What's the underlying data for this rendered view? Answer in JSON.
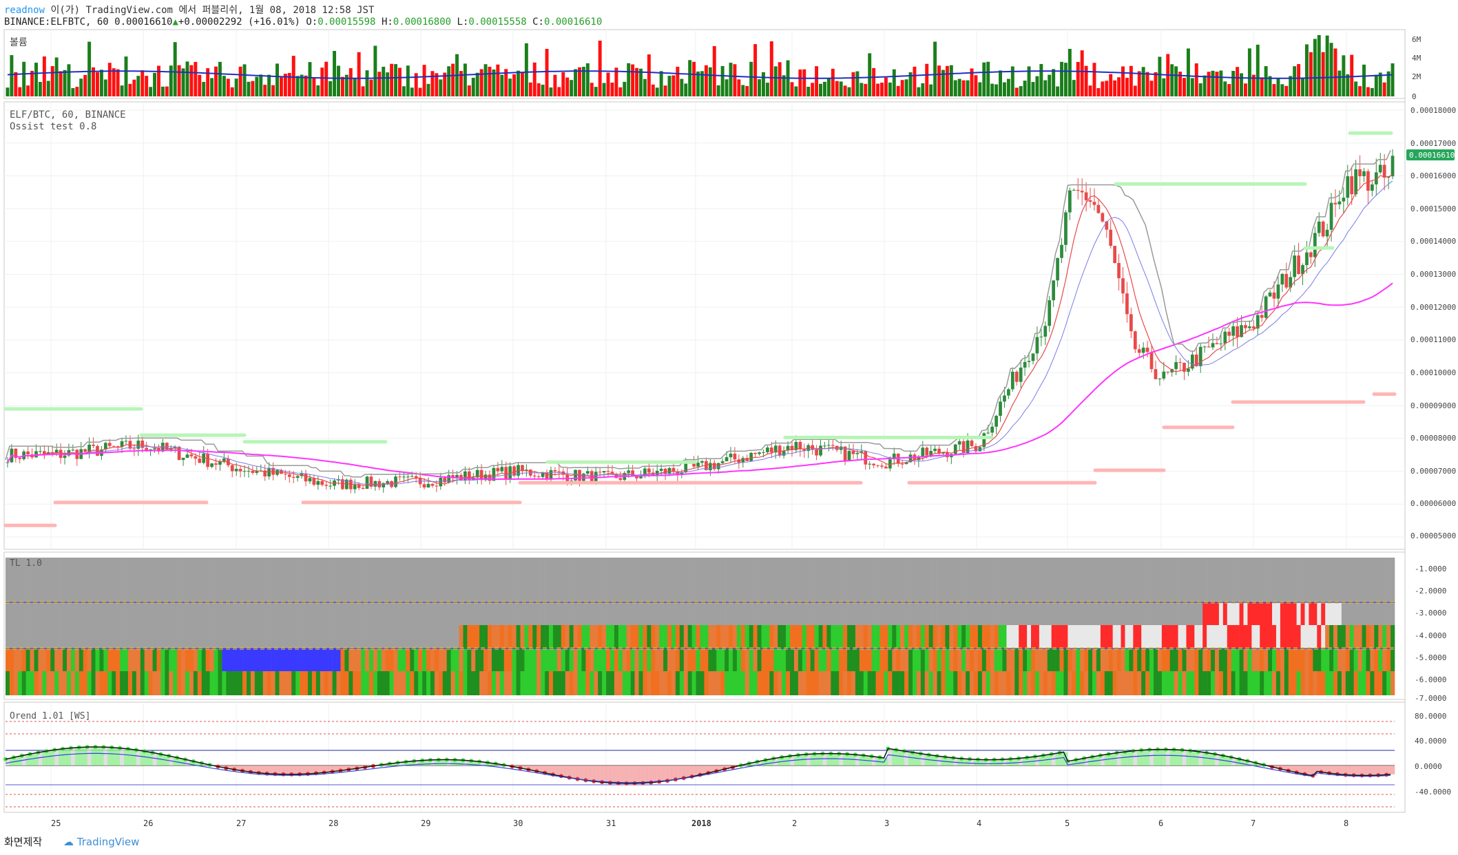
{
  "header": {
    "author": "readnow",
    "publish_text": "이(가) TradingView.com 에서 퍼블리쉬, 1월 08, 2018 12:58 JST",
    "symbol": "BINANCE:ELFBTC, 60",
    "price": "0.00016610",
    "change": "+0.00002292 (+16.01%)",
    "o_label": "O:",
    "o_value": "0.00015598",
    "h_label": "H:",
    "h_value": "0.00016800",
    "l_label": "L:",
    "l_value": "0.00015558",
    "c_label": "C:",
    "c_value": "0.00016610"
  },
  "volume_pane": {
    "title": "볼륨",
    "axis_labels": [
      "6M",
      "4M",
      "2M",
      "0"
    ],
    "up_color": "#1a7f1a",
    "down_color": "#ff1010",
    "ma_color": "#1f2fbf"
  },
  "price_pane": {
    "title": "ELF/BTC, 60, BINANCE",
    "indicator": "Ossist test 0.8",
    "axis_labels": [
      "0.00018000",
      "0.00017000",
      "0.00016000",
      "0.00015000",
      "0.00014000",
      "0.00013000",
      "0.00012000",
      "0.00011000",
      "0.00010000",
      "0.00009000",
      "0.00008000",
      "0.00007000",
      "0.00006000",
      "0.00005000"
    ],
    "last_price_label": "0.00016610",
    "last_price_color": "#26a65b"
  },
  "tl_pane": {
    "title": "TL 1.0",
    "axis_labels": [
      "-1.0000",
      "-2.0000",
      "-3.0000",
      "-4.0000",
      "-5.0000",
      "-6.0000",
      "-7.0000"
    ]
  },
  "orend_pane": {
    "title": "Orend 1.01 [WS]",
    "axis_labels": [
      "80.0000",
      "40.0000",
      "0.0000",
      "-40.0000"
    ]
  },
  "x_axis": {
    "labels": [
      "25",
      "26",
      "27",
      "28",
      "29",
      "30",
      "31",
      "2018",
      "2",
      "3",
      "4",
      "5",
      "6",
      "7",
      "8"
    ]
  },
  "footer": {
    "credit": "화면제작",
    "brand": "TradingView"
  },
  "chart_data": {
    "type": "candlestick",
    "symbol": "ELF/BTC",
    "interval": "60",
    "exchange": "BINANCE",
    "open": 0.00015598,
    "high": 0.000168,
    "low": 0.00015558,
    "close": 0.0001661,
    "ylim": [
      5e-05,
      0.00018
    ],
    "day_close_approx": [
      {
        "x": "25",
        "y": 7.5e-05
      },
      {
        "x": "26",
        "y": 7.8e-05
      },
      {
        "x": "27",
        "y": 7.1e-05
      },
      {
        "x": "28",
        "y": 6.6e-05
      },
      {
        "x": "29",
        "y": 6.7e-05
      },
      {
        "x": "30",
        "y": 7e-05
      },
      {
        "x": "31",
        "y": 6.8e-05
      },
      {
        "x": "2018",
        "y": 7.1e-05
      },
      {
        "x": "2",
        "y": 7.8e-05
      },
      {
        "x": "3",
        "y": 7.3e-05
      },
      {
        "x": "4",
        "y": 7.8e-05
      },
      {
        "x": "5",
        "y": 0.00013
      },
      {
        "x": "6",
        "y": 9.8e-05
      },
      {
        "x": "7",
        "y": 0.000116
      },
      {
        "x": "8",
        "y": 0.000155
      }
    ]
  }
}
